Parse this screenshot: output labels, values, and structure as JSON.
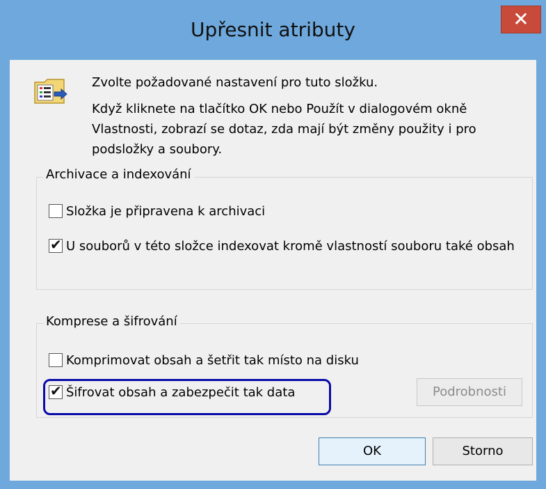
{
  "window": {
    "title": "Upřesnit atributy",
    "close_label": "✕"
  },
  "intro": {
    "line1": "Zvolte požadované nastavení pro tuto složku.",
    "line2": "Když kliknete na tlačítko OK nebo Použít v dialogovém okně Vlastnosti, zobrazí se dotaz, zda mají být změny použity i pro podsložky a soubory."
  },
  "archive_group": {
    "title": "Archivace a indexování",
    "items": [
      {
        "label": "Složka je připravena k archivaci",
        "checked": false
      },
      {
        "label": "U souborů v této složce indexovat kromě vlastností souboru také obsah",
        "checked": true
      }
    ]
  },
  "compress_group": {
    "title": "Komprese a šifrování",
    "items": [
      {
        "label": "Komprimovat obsah a šetřit tak místo na disku",
        "checked": false
      },
      {
        "label": "Šifrovat obsah a zabezpečit tak data",
        "checked": true
      }
    ],
    "details_label": "Podrobnosti"
  },
  "buttons": {
    "ok": "OK",
    "cancel": "Storno"
  },
  "colors": {
    "frame": "#6ea8dc",
    "close": "#c84a3a",
    "highlight": "#0a0aa8"
  }
}
